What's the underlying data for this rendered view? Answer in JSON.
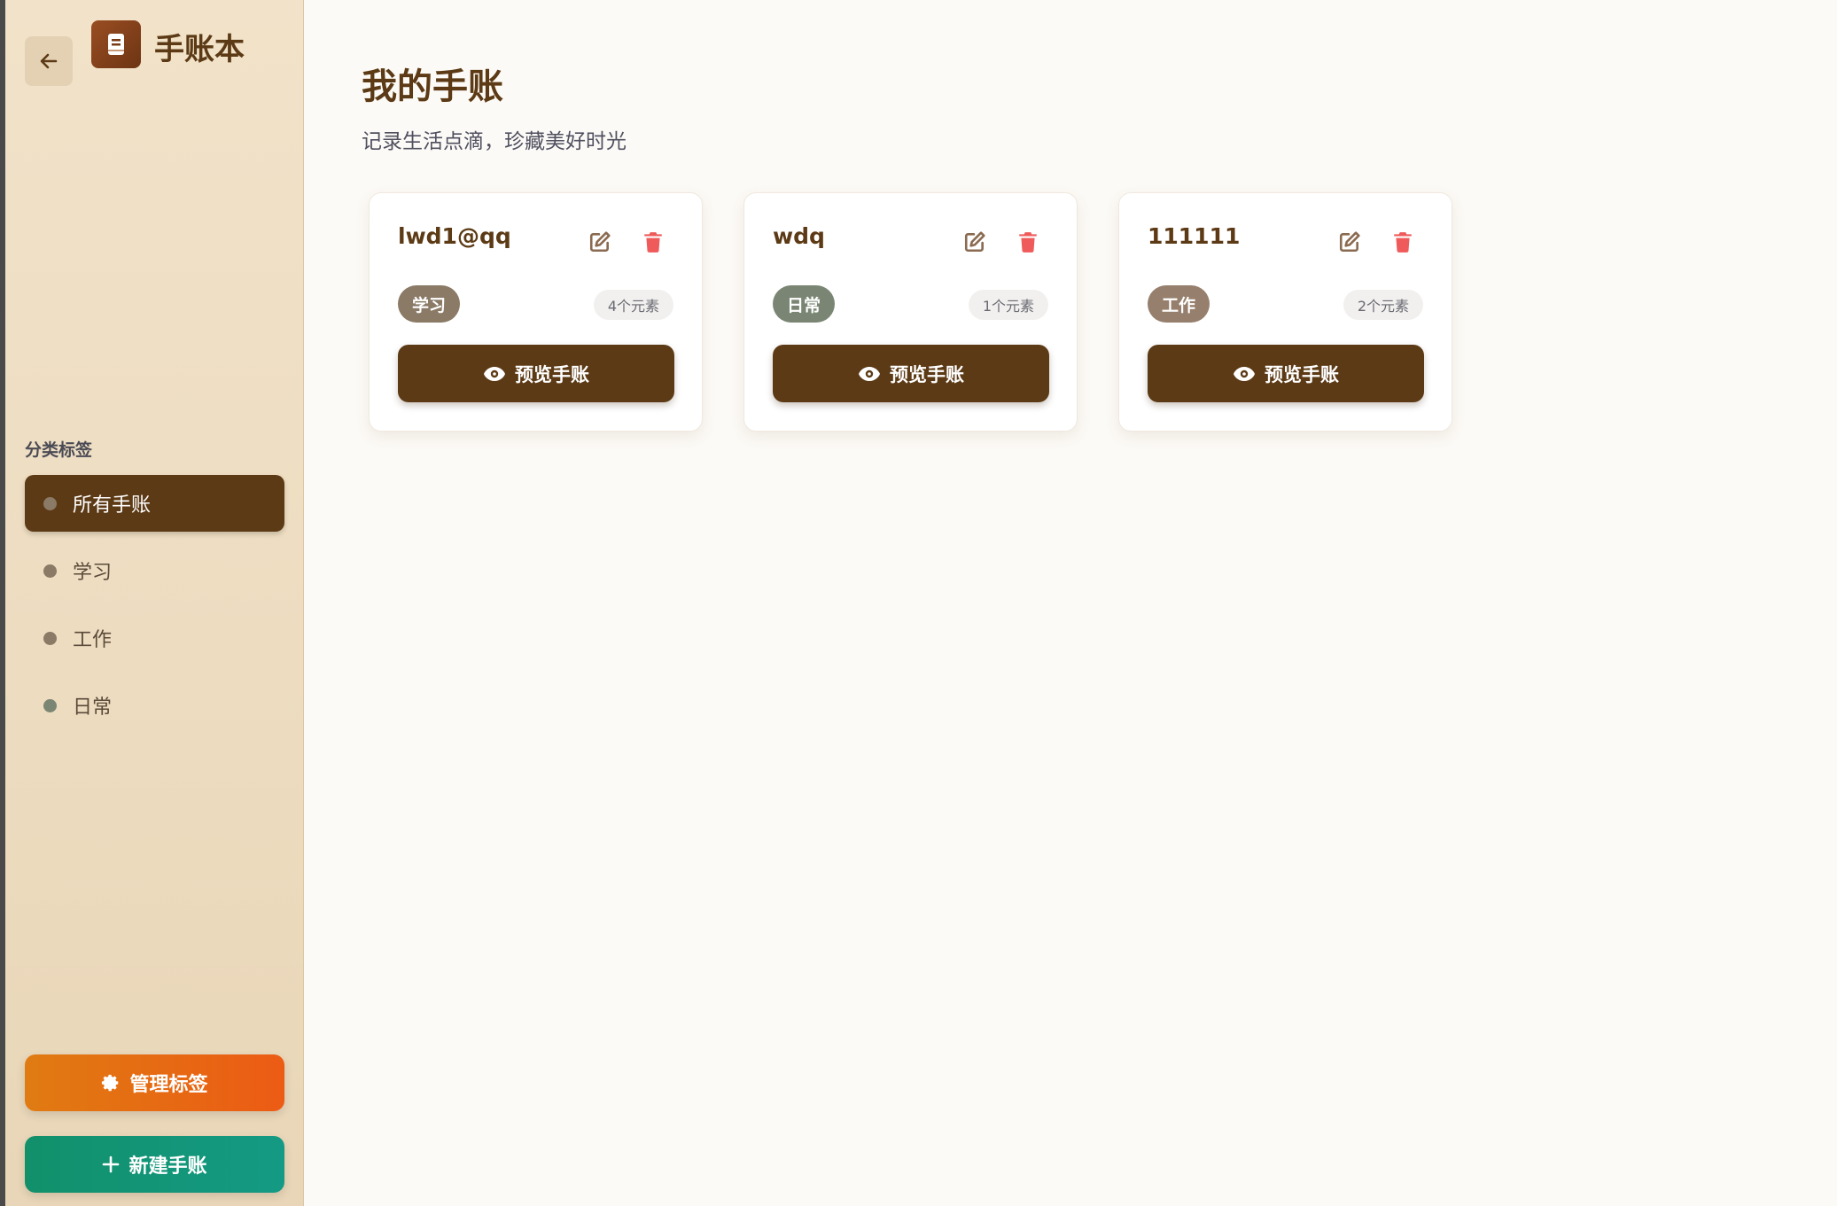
{
  "app": {
    "title": "手账本"
  },
  "sidebar": {
    "section_label": "分类标签",
    "tags": [
      {
        "label": "所有手账",
        "dot_color": "#8a7a66",
        "active": true
      },
      {
        "label": "学习",
        "dot_color": "#8a7a66",
        "active": false
      },
      {
        "label": "工作",
        "dot_color": "#8a7a66",
        "active": false
      },
      {
        "label": "日常",
        "dot_color": "#7a8673",
        "active": false
      }
    ],
    "manage_label": "管理标签",
    "new_label": "新建手账"
  },
  "main": {
    "title": "我的手账",
    "subtitle": "记录生活点滴，珍藏美好时光",
    "cards": [
      {
        "name": "lwd1@qq",
        "tag": "学习",
        "tag_color": "#8a7a66",
        "count": "4个元素",
        "preview_label": "预览手账"
      },
      {
        "name": "wdq",
        "tag": "日常",
        "tag_color": "#7a8673",
        "count": "1个元素",
        "preview_label": "预览手账"
      },
      {
        "name": "111111",
        "tag": "工作",
        "tag_color": "#967f6c",
        "count": "2个元素",
        "preview_label": "预览手账"
      }
    ]
  },
  "colors": {
    "brand_brown": "#5c3a15",
    "delete_red": "#ef5a5a",
    "manage_orange": "#e86a12",
    "new_green": "#11906a"
  }
}
